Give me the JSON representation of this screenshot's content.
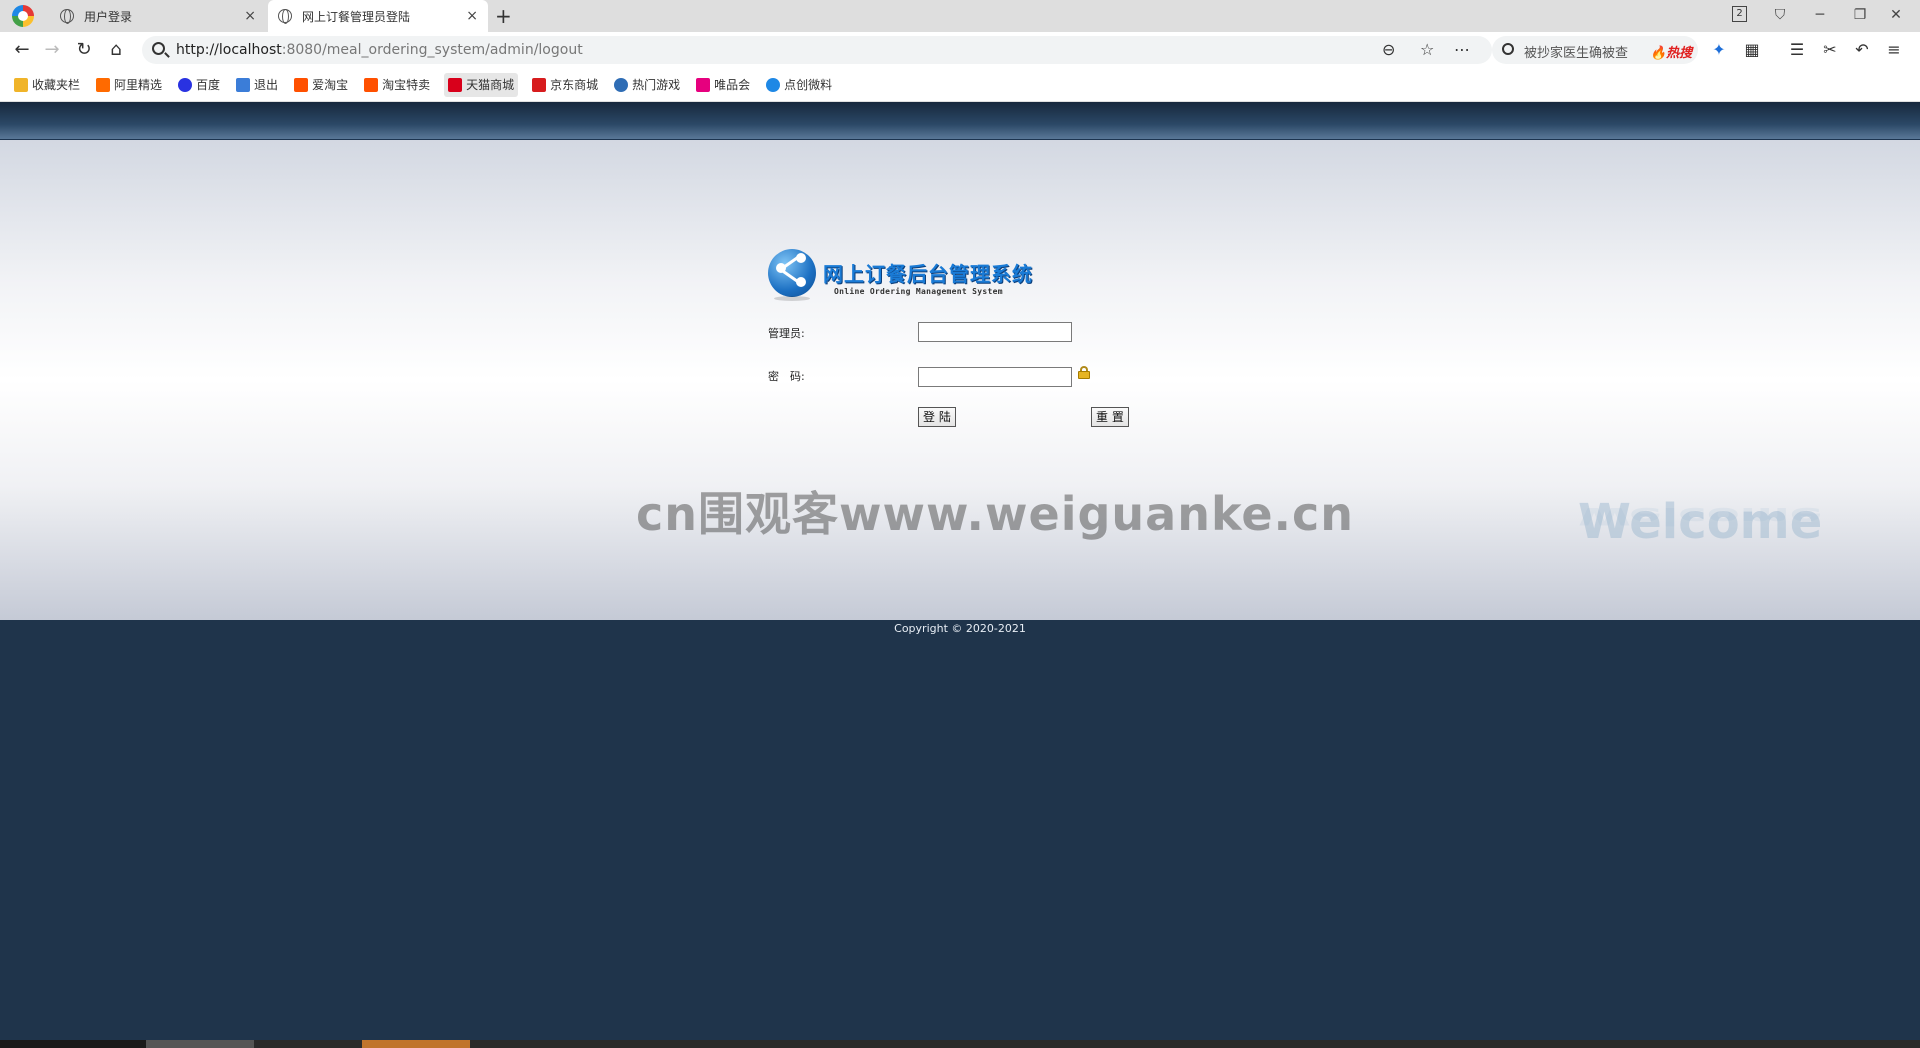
{
  "browser": {
    "tabs": [
      {
        "title": "用户登录",
        "close": "×"
      },
      {
        "title": "网上订餐管理员登陆",
        "close": "×"
      }
    ],
    "new_tab": "+",
    "tab_counter": "2",
    "url_host": "http://localhost",
    "url_rest": ":8080/meal_ordering_system/admin/logout",
    "hot_search": {
      "query": "被抄家医生确被查",
      "badge": "🔥热搜"
    },
    "icons": {
      "back": "back-arrow-icon",
      "forward": "forward-arrow-icon",
      "reload": "reload-icon",
      "home": "home-icon",
      "zoom": "zoom-icon",
      "bookmark_star": "star-icon",
      "more": "more-icon",
      "extension": "puzzle-icon",
      "apps": "grid-icon",
      "favorites": "favorites-icon",
      "screenshot": "scissors-icon",
      "undo": "undo-icon",
      "menu": "menu-icon"
    }
  },
  "bookmarks": [
    {
      "label": "收藏夹栏",
      "icon_color": "#f0b429"
    },
    {
      "label": "阿里精选",
      "icon_color": "#ff6a00"
    },
    {
      "label": "百度",
      "icon_color": "#2932e1"
    },
    {
      "label": "退出",
      "icon_color": "#3b7dd8"
    },
    {
      "label": "爱淘宝",
      "icon_color": "#ff5000"
    },
    {
      "label": "淘宝特卖",
      "icon_color": "#ff5000"
    },
    {
      "label": "天猫商城",
      "icon_color": "#d8001b"
    },
    {
      "label": "京东商城",
      "icon_color": "#d71c1e"
    },
    {
      "label": "热门游戏",
      "icon_color": "#2f6db5"
    },
    {
      "label": "唯品会",
      "icon_color": "#e6007e"
    },
    {
      "label": "点创微料",
      "icon_color": "#1e88e5"
    }
  ],
  "login": {
    "title": "网上订餐后台管理系统",
    "subtitle": "Online Ordering Management System",
    "username_label": "管理员:",
    "username_value": "",
    "password_label": "密　码:",
    "password_value": "",
    "login_button": "登 陆",
    "reset_button": "重 置"
  },
  "watermark": "cn围观客www.weiguanke.cn",
  "welcome": "Welcome",
  "footer": {
    "copyright": "Copyright © 2020-2021"
  },
  "colors": {
    "header_band": "#1f3a58",
    "footer_bg": "#1f344b",
    "title_blue": "#1a7bd6"
  }
}
